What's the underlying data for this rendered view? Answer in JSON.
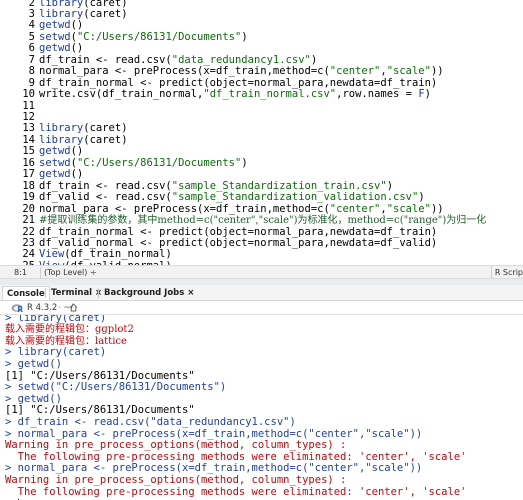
{
  "editor": {
    "lines": [
      {
        "n": "2",
        "tokens": [
          {
            "c": "fn",
            "t": "library"
          },
          {
            "c": "p",
            "t": "(caret)"
          }
        ]
      },
      {
        "n": "3",
        "tokens": [
          {
            "c": "fn",
            "t": "library"
          },
          {
            "c": "p",
            "t": "(caret)"
          }
        ]
      },
      {
        "n": "4",
        "tokens": [
          {
            "c": "fn",
            "t": "getwd"
          },
          {
            "c": "p",
            "t": "()"
          }
        ]
      },
      {
        "n": "5",
        "tokens": [
          {
            "c": "fn",
            "t": "setwd"
          },
          {
            "c": "p",
            "t": "("
          },
          {
            "c": "str",
            "t": "\"C:/Users/86131/Documents\""
          },
          {
            "c": "p",
            "t": ")"
          }
        ]
      },
      {
        "n": "6",
        "tokens": [
          {
            "c": "fn",
            "t": "getwd"
          },
          {
            "c": "p",
            "t": "()"
          }
        ]
      },
      {
        "n": "7",
        "tokens": [
          {
            "c": "p",
            "t": "df_train <- read.csv("
          },
          {
            "c": "str",
            "t": "\"data_redundancy1.csv\""
          },
          {
            "c": "p",
            "t": ")"
          }
        ]
      },
      {
        "n": "8",
        "tokens": [
          {
            "c": "p",
            "t": "normal_para <- preProcess(x=df_train,method=c("
          },
          {
            "c": "str",
            "t": "\"center\""
          },
          {
            "c": "p",
            "t": ","
          },
          {
            "c": "str",
            "t": "\"scale\""
          },
          {
            "c": "p",
            "t": "))"
          }
        ]
      },
      {
        "n": "9",
        "tokens": [
          {
            "c": "p",
            "t": "df_train_normal <- predict(object=normal_para,newdata=df_train)"
          }
        ]
      },
      {
        "n": "10",
        "tokens": [
          {
            "c": "p",
            "t": "write.csv(df_train_normal,"
          },
          {
            "c": "str",
            "t": "\"df_train_normal.csv\""
          },
          {
            "c": "p",
            "t": ",row.names = "
          },
          {
            "c": "bool",
            "t": "F"
          },
          {
            "c": "p",
            "t": ")"
          }
        ]
      },
      {
        "n": "11",
        "tokens": []
      },
      {
        "n": "12",
        "tokens": []
      },
      {
        "n": "13",
        "tokens": [
          {
            "c": "fn",
            "t": "library"
          },
          {
            "c": "p",
            "t": "(caret)"
          }
        ]
      },
      {
        "n": "14",
        "tokens": [
          {
            "c": "fn",
            "t": "library"
          },
          {
            "c": "p",
            "t": "(caret)"
          }
        ]
      },
      {
        "n": "15",
        "tokens": [
          {
            "c": "fn",
            "t": "getwd"
          },
          {
            "c": "p",
            "t": "()"
          }
        ]
      },
      {
        "n": "16",
        "tokens": [
          {
            "c": "fn",
            "t": "setwd"
          },
          {
            "c": "p",
            "t": "("
          },
          {
            "c": "str",
            "t": "\"C:/Users/86131/Documents\""
          },
          {
            "c": "p",
            "t": ")"
          }
        ]
      },
      {
        "n": "17",
        "tokens": [
          {
            "c": "fn",
            "t": "getwd"
          },
          {
            "c": "p",
            "t": "()"
          }
        ]
      },
      {
        "n": "18",
        "tokens": [
          {
            "c": "p",
            "t": "df_train <- read.csv("
          },
          {
            "c": "str",
            "t": "\"sample_Standardization_train.csv\""
          },
          {
            "c": "p",
            "t": ")"
          }
        ]
      },
      {
        "n": "19",
        "tokens": [
          {
            "c": "p",
            "t": "df_valid <- read.csv("
          },
          {
            "c": "str",
            "t": "\"sample_Standardization_validation.csv\""
          },
          {
            "c": "p",
            "t": ")"
          }
        ]
      },
      {
        "n": "20",
        "tokens": [
          {
            "c": "p",
            "t": "normal_para <- preProcess(x=df_train,method=c("
          },
          {
            "c": "str",
            "t": "\"center\""
          },
          {
            "c": "p",
            "t": ","
          },
          {
            "c": "str",
            "t": "\"scale\""
          },
          {
            "c": "p",
            "t": "))"
          }
        ]
      },
      {
        "n": "21",
        "tokens": [
          {
            "c": "cmt",
            "t": "#提取训练集的参数，其中method=c(\"center\",\"scale\")为标准化，method=c(\"range\")为归一化"
          }
        ]
      },
      {
        "n": "22",
        "tokens": [
          {
            "c": "p",
            "t": "df_train_normal <- predict(object=normal_para,newdata=df_train)"
          }
        ]
      },
      {
        "n": "23",
        "tokens": [
          {
            "c": "p",
            "t": "df_valid_normal <- predict(object=normal_para,newdata=df_valid)"
          }
        ]
      },
      {
        "n": "24",
        "tokens": [
          {
            "c": "fn",
            "t": "View"
          },
          {
            "c": "p",
            "t": "(df_train_normal)"
          }
        ]
      },
      {
        "n": "25",
        "tokens": [
          {
            "c": "fn",
            "t": "View"
          },
          {
            "c": "p",
            "t": "(df_valid_normal)"
          }
        ]
      }
    ],
    "status": {
      "position": "8:1",
      "scope": "(Top Level) ÷",
      "file_type": "R Scrip"
    }
  },
  "console_tabs": {
    "console": "Console",
    "terminal": "Terminal ×",
    "background_jobs": "Background Jobs ×"
  },
  "console_toolbar": {
    "r_version": "R 4.3.2",
    "path": "· ~/"
  },
  "console": {
    "lines": [
      {
        "k": "in",
        "t": "> library(caret)"
      },
      {
        "k": "cn",
        "t": "载入需要的程辑包：ggplot2"
      },
      {
        "k": "cn",
        "t": "载入需要的程辑包：lattice"
      },
      {
        "k": "in",
        "t": "> library(caret)"
      },
      {
        "k": "in",
        "t": "> getwd()"
      },
      {
        "k": "out",
        "t": "[1] \"C:/Users/86131/Documents\""
      },
      {
        "k": "in",
        "t": "> setwd(\"C:/Users/86131/Documents\")"
      },
      {
        "k": "in",
        "t": "> getwd()"
      },
      {
        "k": "out",
        "t": "[1] \"C:/Users/86131/Documents\""
      },
      {
        "k": "in",
        "t": "> df_train <- read.csv(\"data_redundancy1.csv\")"
      },
      {
        "k": "in",
        "t": "> normal_para <- preProcess(x=df_train,method=c(\"center\",\"scale\"))"
      },
      {
        "k": "err",
        "t": "Warning in pre_process_options(method, column_types) :"
      },
      {
        "k": "err",
        "t": "  The following pre-processing methods were eliminated: 'center', 'scale'"
      },
      {
        "k": "in",
        "t": "> normal_para <- preProcess(x=df_train,method=c(\"center\",\"scale\"))"
      },
      {
        "k": "err",
        "t": "Warning in pre_process_options(method, column_types) :"
      },
      {
        "k": "err",
        "t": "  The following pre-processing methods were eliminated: 'center', 'scale'"
      },
      {
        "k": "in",
        "t": ">"
      }
    ]
  },
  "colors": {
    "console_input": "#1f3fa8",
    "console_error": "#c5060b",
    "string_literal": "#0a6e0a",
    "keyword": "#1e3a9c"
  }
}
